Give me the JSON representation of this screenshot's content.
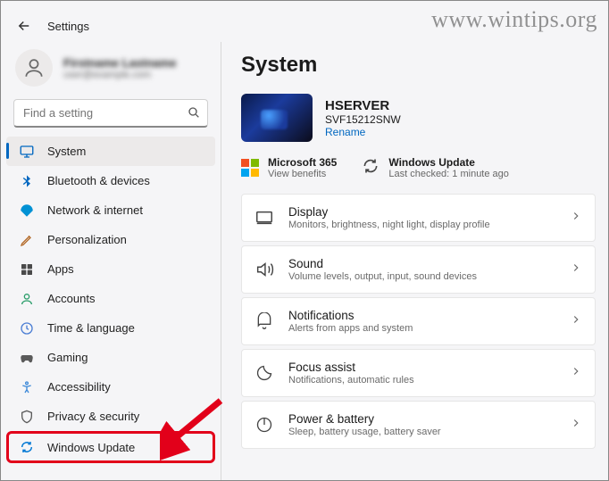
{
  "watermark": "www.wintips.org",
  "header": {
    "title": "Settings"
  },
  "user": {
    "name": "Firstname Lastname",
    "email": "user@example.com"
  },
  "search": {
    "placeholder": "Find a setting"
  },
  "sidebar": {
    "items": [
      {
        "label": "System",
        "icon": "system"
      },
      {
        "label": "Bluetooth & devices",
        "icon": "bluetooth"
      },
      {
        "label": "Network & internet",
        "icon": "network"
      },
      {
        "label": "Personalization",
        "icon": "personalization"
      },
      {
        "label": "Apps",
        "icon": "apps"
      },
      {
        "label": "Accounts",
        "icon": "accounts"
      },
      {
        "label": "Time & language",
        "icon": "time"
      },
      {
        "label": "Gaming",
        "icon": "gaming"
      },
      {
        "label": "Accessibility",
        "icon": "accessibility"
      },
      {
        "label": "Privacy & security",
        "icon": "privacy"
      },
      {
        "label": "Windows Update",
        "icon": "update"
      }
    ]
  },
  "main": {
    "title": "System",
    "device": {
      "name": "HSERVER",
      "model": "SVF15212SNW",
      "rename": "Rename"
    },
    "status": {
      "ms365": {
        "title": "Microsoft 365",
        "sub": "View benefits"
      },
      "update": {
        "title": "Windows Update",
        "sub": "Last checked: 1 minute ago"
      }
    },
    "cards": [
      {
        "title": "Display",
        "sub": "Monitors, brightness, night light, display profile",
        "icon": "display"
      },
      {
        "title": "Sound",
        "sub": "Volume levels, output, input, sound devices",
        "icon": "sound"
      },
      {
        "title": "Notifications",
        "sub": "Alerts from apps and system",
        "icon": "notifications"
      },
      {
        "title": "Focus assist",
        "sub": "Notifications, automatic rules",
        "icon": "focus"
      },
      {
        "title": "Power & battery",
        "sub": "Sleep, battery usage, battery saver",
        "icon": "power"
      }
    ]
  }
}
